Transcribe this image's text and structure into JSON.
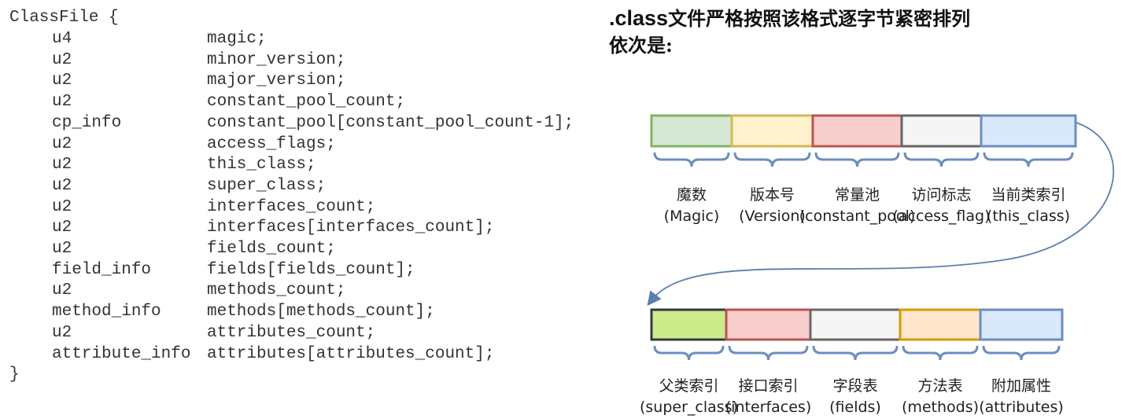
{
  "code": {
    "open_line": "ClassFile {",
    "close_line": "}",
    "rows": [
      {
        "type": "u4",
        "field": "magic;"
      },
      {
        "type": "u2",
        "field": "minor_version;"
      },
      {
        "type": "u2",
        "field": "major_version;"
      },
      {
        "type": "u2",
        "field": "constant_pool_count;"
      },
      {
        "type": "cp_info",
        "field": "constant_pool[constant_pool_count-1];"
      },
      {
        "type": "u2",
        "field": "access_flags;"
      },
      {
        "type": "u2",
        "field": "this_class;"
      },
      {
        "type": "u2",
        "field": "super_class;"
      },
      {
        "type": "u2",
        "field": "interfaces_count;"
      },
      {
        "type": "u2",
        "field": "interfaces[interfaces_count];"
      },
      {
        "type": "u2",
        "field": "fields_count;"
      },
      {
        "type": "field_info",
        "field": "fields[fields_count];"
      },
      {
        "type": "u2",
        "field": "methods_count;"
      },
      {
        "type": "method_info",
        "field": "methods[methods_count];"
      },
      {
        "type": "u2",
        "field": "attributes_count;"
      },
      {
        "type": "attribute_info",
        "field": "attributes[attributes_count];"
      }
    ]
  },
  "diagram": {
    "heading_prefix": ".class",
    "heading_rest": "文件严格按照该格式逐字节紧密排列",
    "heading_line2": "依次是:",
    "row1": [
      {
        "label": "魔数",
        "sub": "(Magic)",
        "fill": "#d5e8d4",
        "stroke": "#82b366"
      },
      {
        "label": "版本号",
        "sub": "(Version)",
        "fill": "#fff2cc",
        "stroke": "#d6b656"
      },
      {
        "label": "常量池",
        "sub": "(constant_pool)",
        "fill": "#f8cecc",
        "stroke": "#b85450"
      },
      {
        "label": "访问标志",
        "sub": "(access_flag)",
        "fill": "#f5f5f5",
        "stroke": "#666666"
      },
      {
        "label": "当前类索引",
        "sub": "(this_class)",
        "fill": "#dae8fc",
        "stroke": "#6c8ebf"
      }
    ],
    "row2": [
      {
        "label": "父类索引",
        "sub": "(super_class)",
        "fill": "#cdeb8b",
        "stroke": "#36393d"
      },
      {
        "label": "接口索引",
        "sub": "(interfaces)",
        "fill": "#f8cecc",
        "stroke": "#b85450"
      },
      {
        "label": "字段表",
        "sub": "(fields)",
        "fill": "#f5f5f5",
        "stroke": "#666666"
      },
      {
        "label": "方法表",
        "sub": "(methods)",
        "fill": "#ffe6cc",
        "stroke": "#d79b00"
      },
      {
        "label": "附加属性",
        "sub": "(attributes)",
        "fill": "#dae8fc",
        "stroke": "#6c8ebf"
      }
    ],
    "brace_color": "#6c8ebf",
    "arrow_color": "#5b7fae"
  }
}
